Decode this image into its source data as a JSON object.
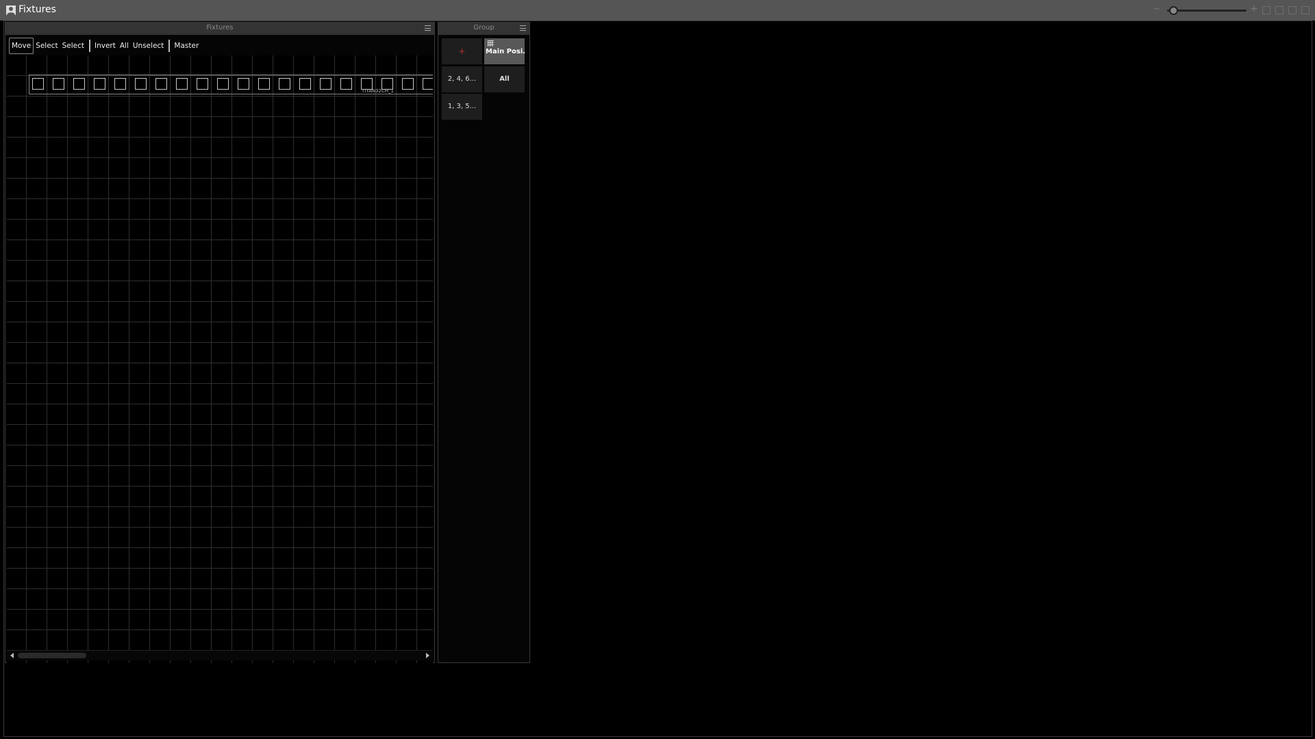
{
  "window": {
    "title": "Fixtures",
    "zoom_minus": "−",
    "zoom_plus": "+",
    "zoom_level": 0.03
  },
  "fixtures_panel": {
    "title": "Fixtures",
    "toolbar": {
      "move": "Move",
      "select_1": "Select",
      "select_2": "Select",
      "invert": "Invert",
      "all": "All",
      "unselect": "Unselect",
      "master": "Master"
    },
    "fixture_group": {
      "label": "TITAN32CH_1",
      "visible_fixture_count": 20
    }
  },
  "group_panel": {
    "title": "Group",
    "tiles": {
      "add": "+",
      "main_position": "Main Posi...",
      "even": "2, 4, 6...",
      "all": "All",
      "odd": "1, 3, 5..."
    }
  }
}
